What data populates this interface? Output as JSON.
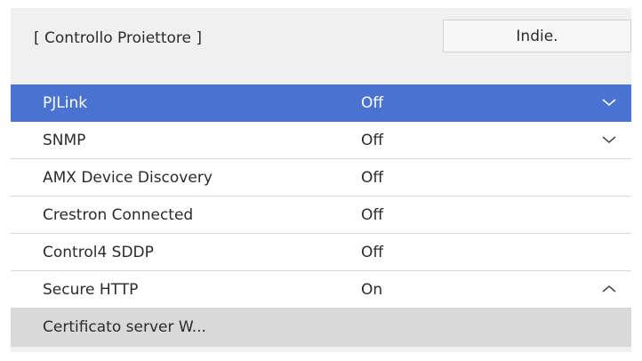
{
  "header": {
    "title": "[ Controllo Proiettore ]",
    "back_label": "Indie."
  },
  "menu": {
    "items": [
      {
        "label": "PJLink",
        "value": "Off",
        "selected": true,
        "icon": "chevron-down-icon"
      },
      {
        "label": "SNMP",
        "value": "Off",
        "selected": false,
        "icon": "chevron-down-icon"
      },
      {
        "label": "AMX Device Discovery",
        "value": "Off",
        "selected": false
      },
      {
        "label": "Crestron Connected",
        "value": "Off",
        "selected": false
      },
      {
        "label": "Control4 SDDP",
        "value": "Off",
        "selected": false
      },
      {
        "label": "Secure HTTP",
        "value": "On",
        "selected": false,
        "icon": "chevron-up-icon"
      },
      {
        "label": "Certificato server W...",
        "value": "",
        "selected": false
      }
    ]
  },
  "colors": {
    "selected_row": "#4a72d0",
    "panel_background": "#f0f0f0",
    "submenu_background": "#d9d9d9"
  }
}
